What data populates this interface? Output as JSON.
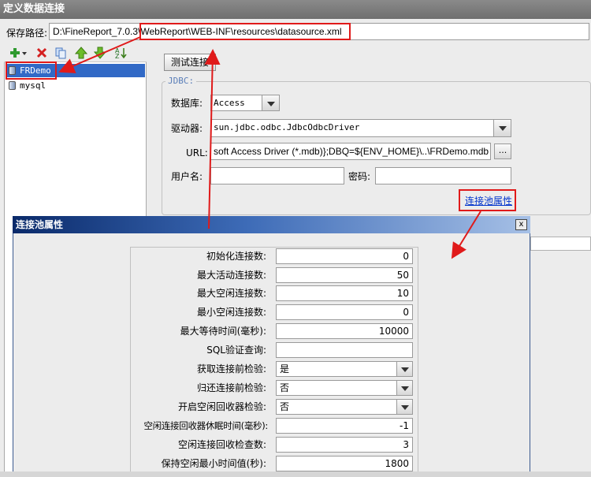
{
  "window": {
    "title": "定义数据连接"
  },
  "save_path": {
    "label": "保存路径:",
    "value": "D:\\FineReport_7.0.3\\WebReport\\WEB-INF\\resources\\datasource.xml"
  },
  "connections": [
    {
      "name": "FRDemo",
      "selected": true
    },
    {
      "name": "mysql",
      "selected": false
    }
  ],
  "toolbar": {
    "icons": [
      "add-icon",
      "delete-icon",
      "copy-icon",
      "move-up-icon",
      "move-down-icon",
      "sort-icon"
    ]
  },
  "test_button": {
    "label": "测试连接"
  },
  "jdbc": {
    "legend": "JDBC:",
    "database_label": "数据库:",
    "database_value": "Access",
    "driver_label": "驱动器:",
    "driver_value": "sun.jdbc.odbc.JdbcOdbcDriver",
    "url_label": "URL:",
    "url_value": "soft Access Driver (*.mdb)};DBQ=${ENV_HOME}\\..\\FRDemo.mdb",
    "url_button": "...",
    "username_label": "用户名:",
    "username_value": "",
    "password_label": "密码:",
    "password_value": ""
  },
  "pool_link": {
    "label": "连接池属性"
  },
  "pool_dialog": {
    "title": "连接池属性",
    "close": "x",
    "fields": [
      {
        "label": "初始化连接数:",
        "value": "0",
        "type": "number"
      },
      {
        "label": "最大活动连接数:",
        "value": "50",
        "type": "number"
      },
      {
        "label": "最大空闲连接数:",
        "value": "10",
        "type": "number"
      },
      {
        "label": "最小空闲连接数:",
        "value": "0",
        "type": "number"
      },
      {
        "label": "最大等待时间(毫秒):",
        "value": "10000",
        "type": "number"
      },
      {
        "label": "SQL验证查询:",
        "value": "",
        "type": "text"
      },
      {
        "label": "获取连接前检验:",
        "value": "是",
        "type": "select"
      },
      {
        "label": "归还连接前检验:",
        "value": "否",
        "type": "select"
      },
      {
        "label": "开启空闲回收器检验:",
        "value": "否",
        "type": "select"
      },
      {
        "label": "空闲连接回收器休眠时间(毫秒):",
        "value": "-1",
        "type": "number"
      },
      {
        "label": "空闲连接回收检查数:",
        "value": "3",
        "type": "number"
      },
      {
        "label": "保持空闲最小时间值(秒):",
        "value": "1800",
        "type": "number"
      }
    ]
  },
  "colors": {
    "highlight": "#e01a1a",
    "selection": "#3169c6",
    "dialog_title": "#0a2a6a",
    "link": "#0033cc"
  }
}
